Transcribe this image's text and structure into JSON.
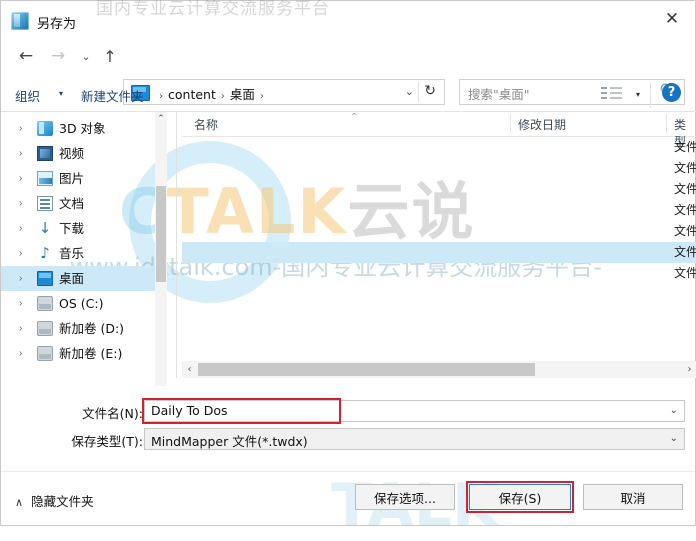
{
  "window": {
    "title": "另存为",
    "title_icon": "mindmapper-app-icon",
    "close_icon": "✕"
  },
  "nav": {
    "back_icon": "←",
    "forward_icon": "→",
    "recent_icon": "⌄",
    "up_icon": "↑",
    "refresh_icon": "↻",
    "dropdown_icon": "⌄",
    "breadcrumbs": [
      "content",
      "桌面"
    ],
    "separator": "›"
  },
  "search": {
    "placeholder": "搜索\"桌面\"",
    "icon": "search-icon"
  },
  "toolbar": {
    "organize_label": "组织",
    "organize_caret": "▾",
    "new_folder_label": "新建文件夹",
    "view_caret": "▾",
    "help_label": "?"
  },
  "sidebar": {
    "scroll_up_icon": "⌃",
    "items": [
      {
        "label": "3D 对象",
        "icon": "cube-icon",
        "chevron": "›",
        "selected": false
      },
      {
        "label": "视频",
        "icon": "video-icon",
        "chevron": "›",
        "selected": false
      },
      {
        "label": "图片",
        "icon": "picture-icon",
        "chevron": "›",
        "selected": false
      },
      {
        "label": "文档",
        "icon": "document-icon",
        "chevron": "›",
        "selected": false
      },
      {
        "label": "下载",
        "icon": "download-icon",
        "chevron": "›",
        "selected": false
      },
      {
        "label": "音乐",
        "icon": "music-icon",
        "chevron": "›",
        "selected": false
      },
      {
        "label": "桌面",
        "icon": "desktop-icon",
        "chevron": "›",
        "selected": true
      },
      {
        "label": "OS (C:)",
        "icon": "os-drive-icon",
        "chevron": "›",
        "selected": false
      },
      {
        "label": "新加卷 (D:)",
        "icon": "drive-icon",
        "chevron": "›",
        "selected": false
      },
      {
        "label": "新加卷 (E:)",
        "icon": "drive-icon",
        "chevron": "›",
        "selected": false
      }
    ]
  },
  "filelist": {
    "columns": {
      "name": "名称",
      "date": "修改日期",
      "type": "类型"
    },
    "sort_indicator": "⌃",
    "rows": [
      {
        "name": "",
        "date": "",
        "type": "文件"
      },
      {
        "name": "",
        "date": "",
        "type": "文件"
      },
      {
        "name": "",
        "date": "",
        "type": "文件"
      },
      {
        "name": "",
        "date": "",
        "type": "文件"
      },
      {
        "name": "",
        "date": "",
        "type": "文件"
      },
      {
        "name": "",
        "date": "",
        "type": "文件",
        "selected": true
      },
      {
        "name": "",
        "date": "",
        "type": "文件"
      }
    ],
    "hscroll": {
      "left_icon": "‹",
      "right_icon": "›"
    }
  },
  "form": {
    "filename_label": "文件名(N):",
    "filename_value": "Daily To Dos",
    "filetype_label": "保存类型(T):",
    "filetype_value": "MindMapper 文件(*.twdx)",
    "dropdown_icon": "⌄"
  },
  "footer": {
    "hide_folders_label": "隐藏文件夹",
    "hide_folders_chevron": "∧",
    "save_options_label": "保存选项...",
    "save_label": "保存(S)",
    "cancel_label": "取消"
  },
  "watermark": {
    "top_text": "国内专业云计算交流服务平台",
    "logo_c": "C",
    "logo_talk": "TALK",
    "logo_cn": "云说",
    "url_text": "-www.idctalk.com-国内专业云计算交流服务平台-",
    "bottom_text": "TALK"
  },
  "colors": {
    "selection": "#cde8f7",
    "accent": "#1573c4",
    "highlight_red": "#cf2233",
    "focus_blue": "#2d7ec4",
    "link_blue": "#16447a"
  }
}
